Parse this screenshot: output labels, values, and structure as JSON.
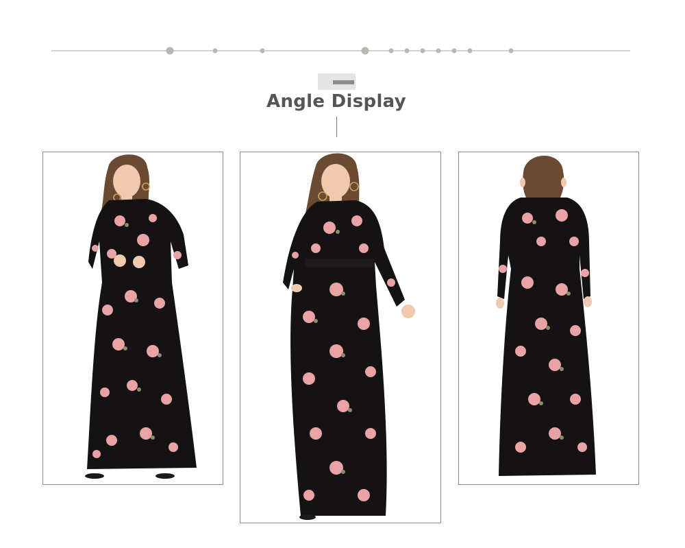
{
  "section": {
    "title": "Angle Display"
  },
  "colors": {
    "line": "#b8b8b0",
    "dot": "#b8b8b0",
    "dress": "#141212",
    "flower": "#e9a3a5",
    "flower_light": "#f5c9c8",
    "leaf": "#8f8b6b",
    "skin": "#f0c9ae",
    "hair": "#6b4a34"
  },
  "views": [
    {
      "name": "front-view",
      "icon": "dress-front-photo"
    },
    {
      "name": "front-pocket-view",
      "icon": "dress-front-pocket-photo"
    },
    {
      "name": "back-view",
      "icon": "dress-back-photo"
    }
  ]
}
